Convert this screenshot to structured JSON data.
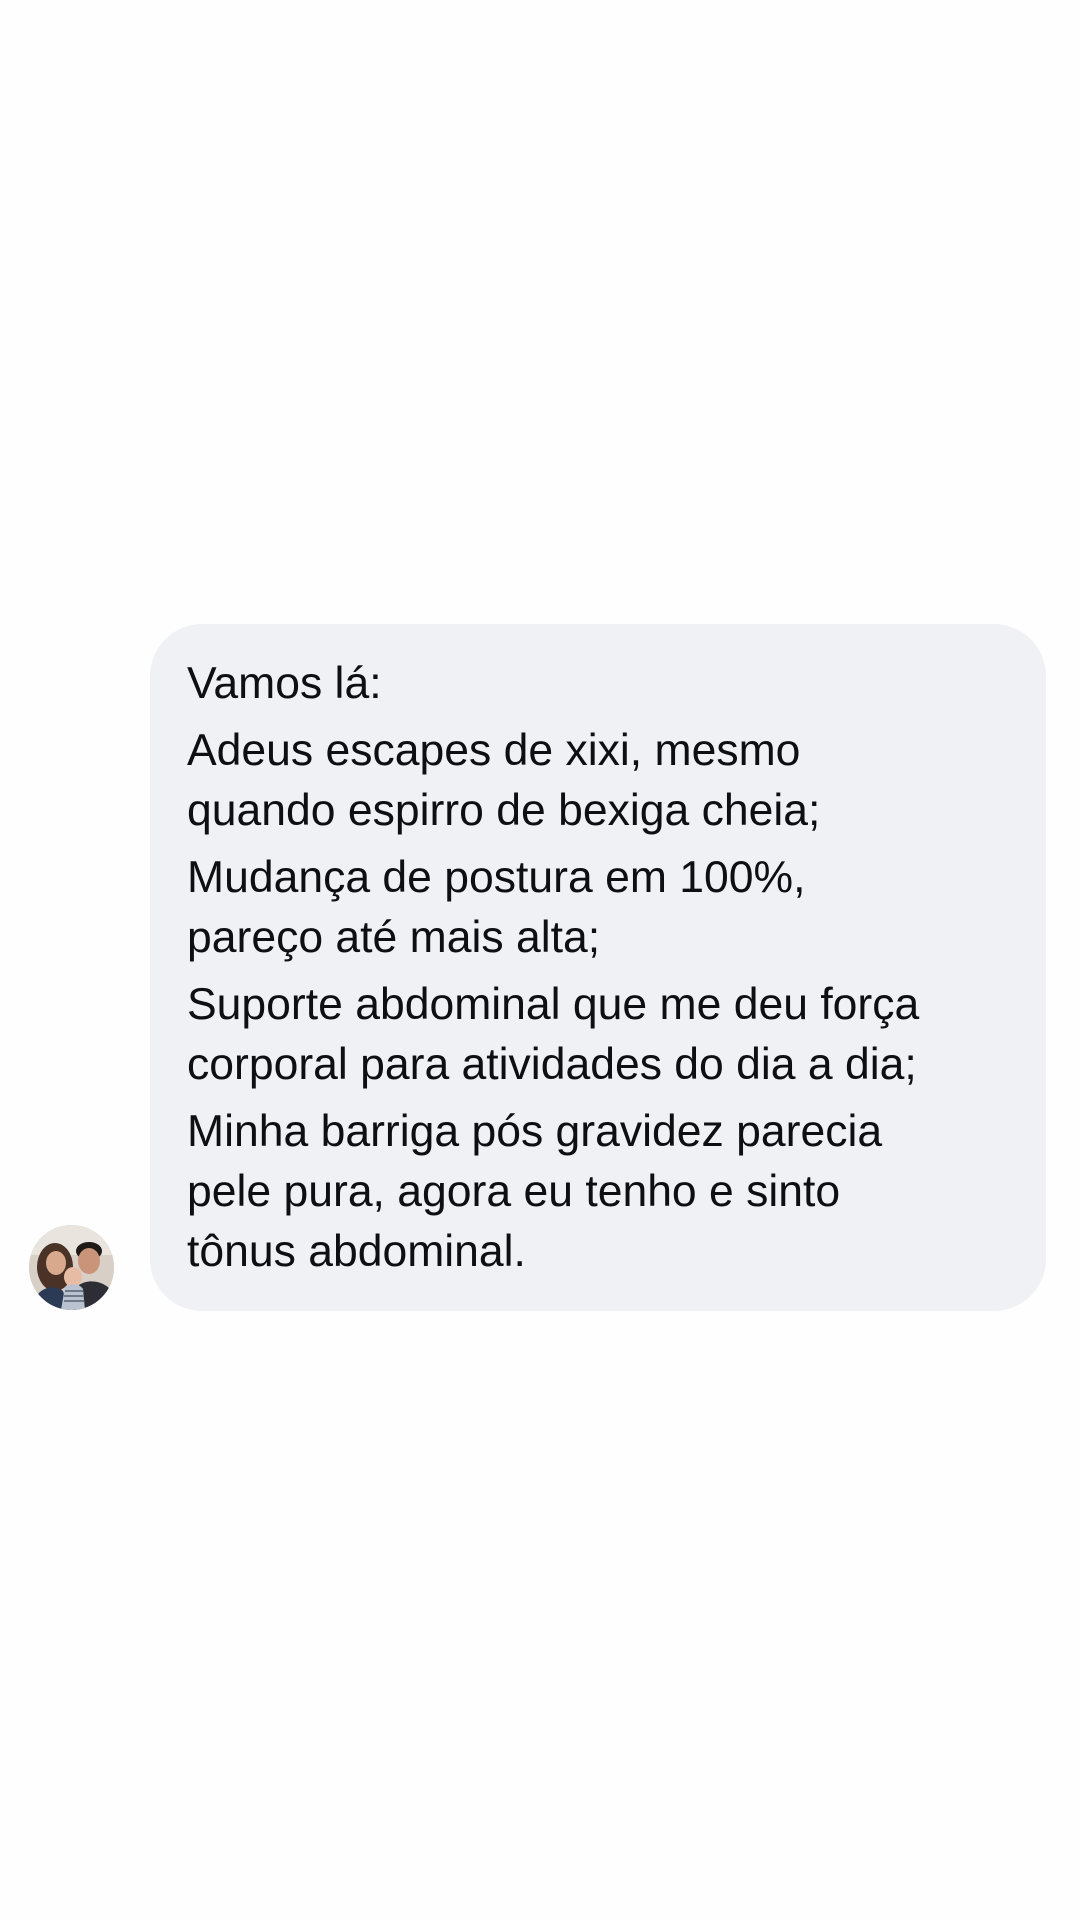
{
  "conversation": {
    "message": {
      "paragraphs": [
        {
          "lines": [
            "Vamos lá:"
          ]
        },
        {
          "lines": [
            "Adeus escapes de xixi, mesmo",
            "quando espirro de bexiga cheia;"
          ]
        },
        {
          "lines": [
            "Mudança de postura em 100%,",
            "pareço até mais alta;"
          ]
        },
        {
          "lines": [
            "Suporte abdominal que me deu força",
            "corporal para atividades do dia a dia;"
          ]
        },
        {
          "lines": [
            "Minha barriga pós gravidez parecia",
            "pele pura, agora eu tenho e sinto",
            "tônus abdominal."
          ]
        }
      ]
    }
  },
  "colors": {
    "page_background": "#fefefe",
    "bubble_background": "#eff1f4",
    "text": "#0d0f12"
  }
}
